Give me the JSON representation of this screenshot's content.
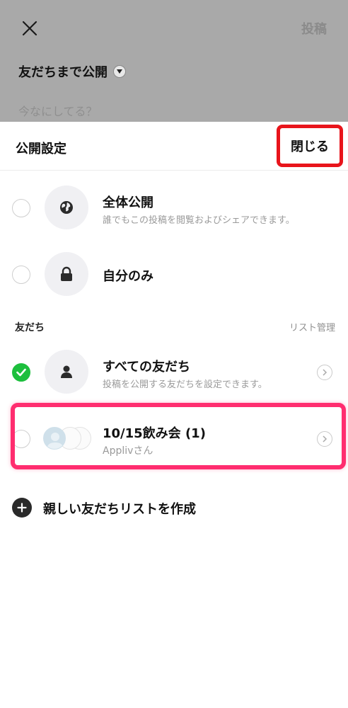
{
  "composer": {
    "post_label": "投稿",
    "audience_label": "友だちまで公開",
    "placeholder": "今なにしてる？"
  },
  "sheet": {
    "title": "公開設定",
    "close_label": "閉じる"
  },
  "privacy_options": [
    {
      "title": "全体公開",
      "subtitle": "誰でもこの投稿を閲覧およびシェアできます。",
      "icon": "globe-icon",
      "selected": false
    },
    {
      "title": "自分のみ",
      "subtitle": "",
      "icon": "lock-icon",
      "selected": false
    }
  ],
  "friends_section": {
    "label": "友だち",
    "manage_label": "リスト管理",
    "items": [
      {
        "title": "すべての友だち",
        "subtitle": "投稿を公開する友だちを設定できます。",
        "icon": "person-icon",
        "selected": true
      },
      {
        "title": "10/15飲み会 (1)",
        "subtitle": "Applivさん",
        "icon": "group-avatars-icon",
        "selected": false
      }
    ]
  },
  "create_list_label": "親しい友だちリストを作成",
  "colors": {
    "accent_green": "#1dbf3d",
    "annotation_red": "#e8141b",
    "annotation_pink": "#ff2d6f",
    "overlay_gray": "#a9a9a9"
  }
}
